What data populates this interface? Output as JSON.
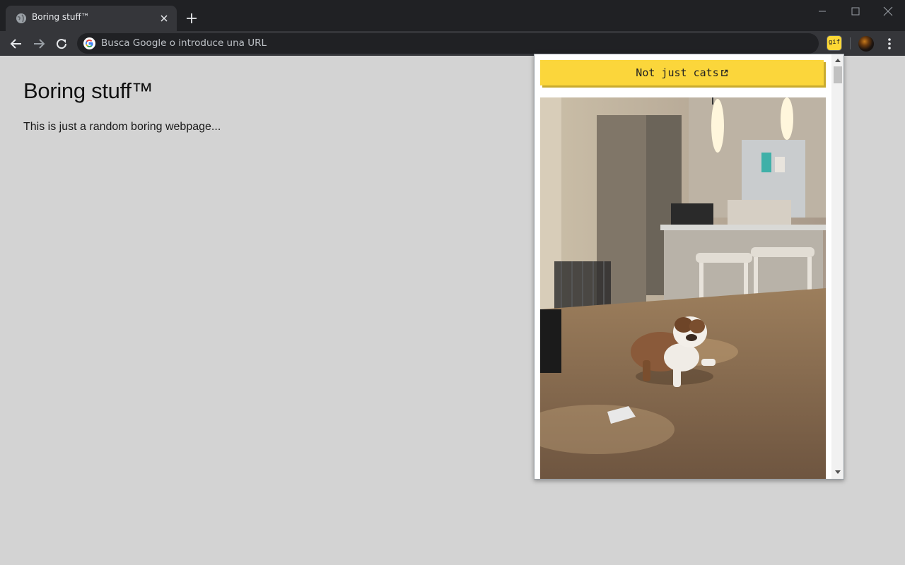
{
  "browser": {
    "tab_title": "Boring stuff™",
    "omnibox_placeholder": "Busca Google o introduce una URL",
    "extension_badge": "gif"
  },
  "page": {
    "title": "Boring stuff™",
    "text": "This is just a random boring webpage..."
  },
  "popup": {
    "button_label": "Not just cats",
    "image_subject": "bulldog-gif",
    "accent_color": "#fbd63b"
  },
  "colors": {
    "chrome_dark": "#202124",
    "chrome_toolbar": "#35363a",
    "page_bg": "#d3d3d3"
  }
}
